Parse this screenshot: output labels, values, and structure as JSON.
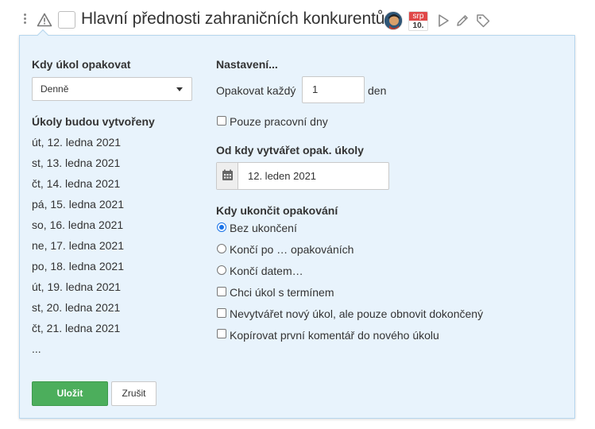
{
  "header": {
    "title": "Hlavní přednosti zahraničních konkurentů",
    "due_badge": {
      "month": "srp",
      "day": "10."
    },
    "icons": [
      "drag-handle-icon",
      "warning-icon",
      "play-icon",
      "pencil-icon",
      "tag-icon"
    ]
  },
  "left": {
    "repeat_label": "Kdy úkol opakovat",
    "repeat_selected": "Denně",
    "created_label": "Úkoly budou vytvořeny",
    "dates": [
      "út, 12. ledna 2021",
      "st, 13. ledna 2021",
      "čt, 14. ledna 2021",
      "pá, 15. ledna 2021",
      "so, 16. ledna 2021",
      "ne, 17. ledna 2021",
      "po, 18. ledna 2021",
      "út, 19. ledna 2021",
      "st, 20. ledna 2021",
      "čt, 21. ledna 2021",
      "..."
    ]
  },
  "right": {
    "settings_label": "Nastavení...",
    "repeat_every_label": "Opakovat každý",
    "repeat_every_value": "1",
    "repeat_unit": "den",
    "workdays_label": "Pouze pracovní dny",
    "start_label": "Od kdy vytvářet opak. úkoly",
    "start_value": "12. leden 2021",
    "end_label": "Kdy ukončit opakování",
    "end_options": [
      {
        "label": "Bez ukončení",
        "checked": true
      },
      {
        "label": "Končí po … opakováních",
        "checked": false
      },
      {
        "label": "Končí datem…",
        "checked": false
      }
    ],
    "checkboxes": [
      "Chci úkol s termínem",
      "Nevytvářet nový úkol, ale pouze obnovit dokončený",
      "Kopírovat první komentář do nového úkolu"
    ]
  },
  "buttons": {
    "save": "Uložit",
    "cancel": "Zrušit"
  },
  "colors": {
    "panel_bg": "#e8f3fc",
    "save_green": "#4cae5c",
    "badge_red": "#e04848",
    "radio_blue": "#1a73e8"
  }
}
